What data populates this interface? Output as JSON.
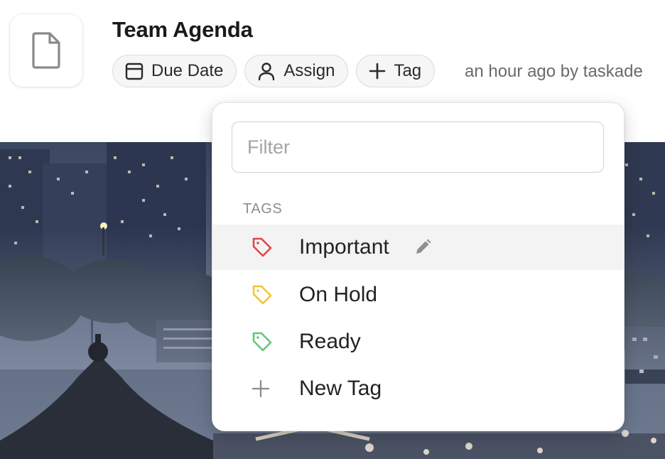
{
  "document": {
    "title": "Team Agenda",
    "icon": "document-icon"
  },
  "toolbar": {
    "due_date_label": "Due Date",
    "assign_label": "Assign",
    "tag_label": "Tag",
    "meta_text": "an hour ago by taskade"
  },
  "tag_menu": {
    "filter_placeholder": "Filter",
    "filter_value": "",
    "section_label": "TAGS",
    "tags": [
      {
        "label": "Important",
        "color": "#e0464e",
        "icon": "tag-icon"
      },
      {
        "label": "On Hold",
        "color": "#f2c530",
        "icon": "tag-icon"
      },
      {
        "label": "Ready",
        "color": "#63c77a",
        "icon": "tag-icon"
      }
    ],
    "new_tag_label": "New Tag",
    "edit_icon": "pencil-icon"
  },
  "cover": {
    "kind": "city-night-photo"
  }
}
